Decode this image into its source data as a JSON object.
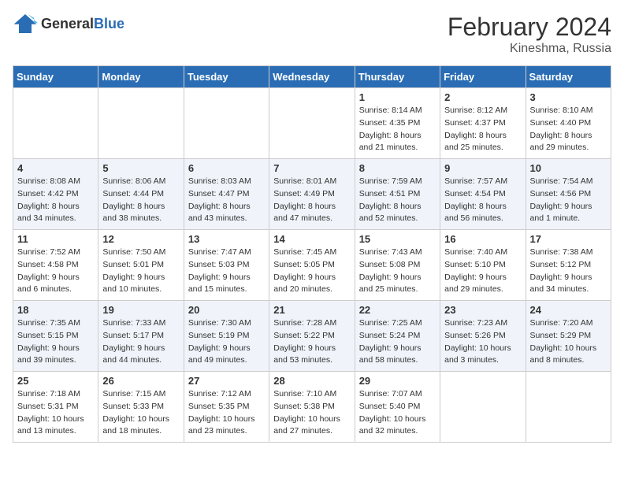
{
  "logo": {
    "general": "General",
    "blue": "Blue"
  },
  "header": {
    "month_year": "February 2024",
    "location": "Kineshma, Russia"
  },
  "weekdays": [
    "Sunday",
    "Monday",
    "Tuesday",
    "Wednesday",
    "Thursday",
    "Friday",
    "Saturday"
  ],
  "weeks": [
    [
      {
        "day": "",
        "info": ""
      },
      {
        "day": "",
        "info": ""
      },
      {
        "day": "",
        "info": ""
      },
      {
        "day": "",
        "info": ""
      },
      {
        "day": "1",
        "info": "Sunrise: 8:14 AM\nSunset: 4:35 PM\nDaylight: 8 hours\nand 21 minutes."
      },
      {
        "day": "2",
        "info": "Sunrise: 8:12 AM\nSunset: 4:37 PM\nDaylight: 8 hours\nand 25 minutes."
      },
      {
        "day": "3",
        "info": "Sunrise: 8:10 AM\nSunset: 4:40 PM\nDaylight: 8 hours\nand 29 minutes."
      }
    ],
    [
      {
        "day": "4",
        "info": "Sunrise: 8:08 AM\nSunset: 4:42 PM\nDaylight: 8 hours\nand 34 minutes."
      },
      {
        "day": "5",
        "info": "Sunrise: 8:06 AM\nSunset: 4:44 PM\nDaylight: 8 hours\nand 38 minutes."
      },
      {
        "day": "6",
        "info": "Sunrise: 8:03 AM\nSunset: 4:47 PM\nDaylight: 8 hours\nand 43 minutes."
      },
      {
        "day": "7",
        "info": "Sunrise: 8:01 AM\nSunset: 4:49 PM\nDaylight: 8 hours\nand 47 minutes."
      },
      {
        "day": "8",
        "info": "Sunrise: 7:59 AM\nSunset: 4:51 PM\nDaylight: 8 hours\nand 52 minutes."
      },
      {
        "day": "9",
        "info": "Sunrise: 7:57 AM\nSunset: 4:54 PM\nDaylight: 8 hours\nand 56 minutes."
      },
      {
        "day": "10",
        "info": "Sunrise: 7:54 AM\nSunset: 4:56 PM\nDaylight: 9 hours\nand 1 minute."
      }
    ],
    [
      {
        "day": "11",
        "info": "Sunrise: 7:52 AM\nSunset: 4:58 PM\nDaylight: 9 hours\nand 6 minutes."
      },
      {
        "day": "12",
        "info": "Sunrise: 7:50 AM\nSunset: 5:01 PM\nDaylight: 9 hours\nand 10 minutes."
      },
      {
        "day": "13",
        "info": "Sunrise: 7:47 AM\nSunset: 5:03 PM\nDaylight: 9 hours\nand 15 minutes."
      },
      {
        "day": "14",
        "info": "Sunrise: 7:45 AM\nSunset: 5:05 PM\nDaylight: 9 hours\nand 20 minutes."
      },
      {
        "day": "15",
        "info": "Sunrise: 7:43 AM\nSunset: 5:08 PM\nDaylight: 9 hours\nand 25 minutes."
      },
      {
        "day": "16",
        "info": "Sunrise: 7:40 AM\nSunset: 5:10 PM\nDaylight: 9 hours\nand 29 minutes."
      },
      {
        "day": "17",
        "info": "Sunrise: 7:38 AM\nSunset: 5:12 PM\nDaylight: 9 hours\nand 34 minutes."
      }
    ],
    [
      {
        "day": "18",
        "info": "Sunrise: 7:35 AM\nSunset: 5:15 PM\nDaylight: 9 hours\nand 39 minutes."
      },
      {
        "day": "19",
        "info": "Sunrise: 7:33 AM\nSunset: 5:17 PM\nDaylight: 9 hours\nand 44 minutes."
      },
      {
        "day": "20",
        "info": "Sunrise: 7:30 AM\nSunset: 5:19 PM\nDaylight: 9 hours\nand 49 minutes."
      },
      {
        "day": "21",
        "info": "Sunrise: 7:28 AM\nSunset: 5:22 PM\nDaylight: 9 hours\nand 53 minutes."
      },
      {
        "day": "22",
        "info": "Sunrise: 7:25 AM\nSunset: 5:24 PM\nDaylight: 9 hours\nand 58 minutes."
      },
      {
        "day": "23",
        "info": "Sunrise: 7:23 AM\nSunset: 5:26 PM\nDaylight: 10 hours\nand 3 minutes."
      },
      {
        "day": "24",
        "info": "Sunrise: 7:20 AM\nSunset: 5:29 PM\nDaylight: 10 hours\nand 8 minutes."
      }
    ],
    [
      {
        "day": "25",
        "info": "Sunrise: 7:18 AM\nSunset: 5:31 PM\nDaylight: 10 hours\nand 13 minutes."
      },
      {
        "day": "26",
        "info": "Sunrise: 7:15 AM\nSunset: 5:33 PM\nDaylight: 10 hours\nand 18 minutes."
      },
      {
        "day": "27",
        "info": "Sunrise: 7:12 AM\nSunset: 5:35 PM\nDaylight: 10 hours\nand 23 minutes."
      },
      {
        "day": "28",
        "info": "Sunrise: 7:10 AM\nSunset: 5:38 PM\nDaylight: 10 hours\nand 27 minutes."
      },
      {
        "day": "29",
        "info": "Sunrise: 7:07 AM\nSunset: 5:40 PM\nDaylight: 10 hours\nand 32 minutes."
      },
      {
        "day": "",
        "info": ""
      },
      {
        "day": "",
        "info": ""
      }
    ]
  ]
}
